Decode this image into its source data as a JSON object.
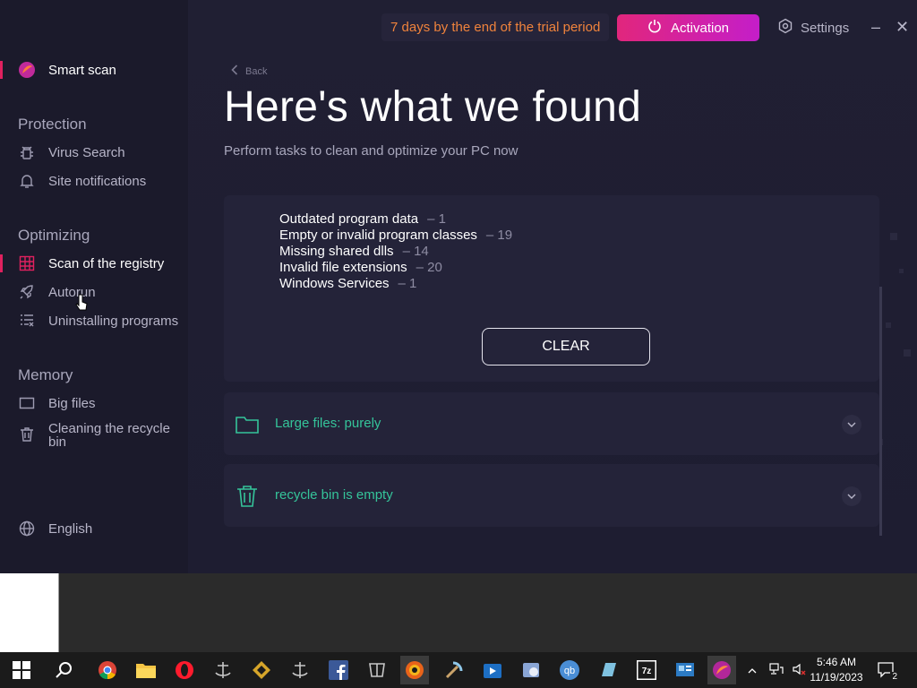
{
  "sidebar": {
    "smart_scan": "Smart scan",
    "protection_heading": "Protection",
    "virus_search": "Virus Search",
    "site_notifications": "Site notifications",
    "optimizing_heading": "Optimizing",
    "scan_registry": "Scan of the registry",
    "autorun": "Autorun",
    "uninstalling": "Uninstalling programs",
    "memory_heading": "Memory",
    "big_files": "Big files",
    "recycle_line1": "Cleaning the recycle",
    "recycle_line2": "bin",
    "language": "English"
  },
  "topbar": {
    "trial_text": "7 days by the end of the trial period",
    "activation_label": "Activation",
    "settings_label": "Settings",
    "minimize": "–",
    "close": "✕"
  },
  "main": {
    "back_label": "Back",
    "title": "Here's what we found",
    "subtitle": "Perform tasks to clean and optimize your PC now",
    "issues": [
      {
        "name": "Outdated program data",
        "count": "– 1"
      },
      {
        "name": "Empty or invalid program classes",
        "count": "– 19"
      },
      {
        "name": "Missing shared dlls",
        "count": "– 14"
      },
      {
        "name": "Invalid file extensions",
        "count": "– 20"
      },
      {
        "name": "Windows Services",
        "count": "– 1"
      }
    ],
    "clear_label": "CLEAR",
    "large_files_label": "Large files: purely",
    "recycle_bin_label": "recycle bin is empty"
  },
  "taskbar": {
    "time": "5:46 AM",
    "date": "11/19/2023",
    "notification_count": "2",
    "icons": [
      "windows-start",
      "search",
      "chrome",
      "file-explorer",
      "opera",
      "world-of-warships",
      "game-app",
      "world-of-warships-2",
      "facebook",
      "world-of-tanks",
      "browser-app",
      "pickaxe-app",
      "media-app",
      "photo-app",
      "qbittorrent",
      "notes-app",
      "7zip",
      "control-panel",
      "cleaner-app"
    ]
  },
  "colors": {
    "accent_pink": "#e0215f",
    "activation_gradient_start": "#e1267c",
    "activation_gradient_end": "#c41ec9",
    "trial_orange": "#f0833c",
    "success_green": "#35c49a"
  }
}
